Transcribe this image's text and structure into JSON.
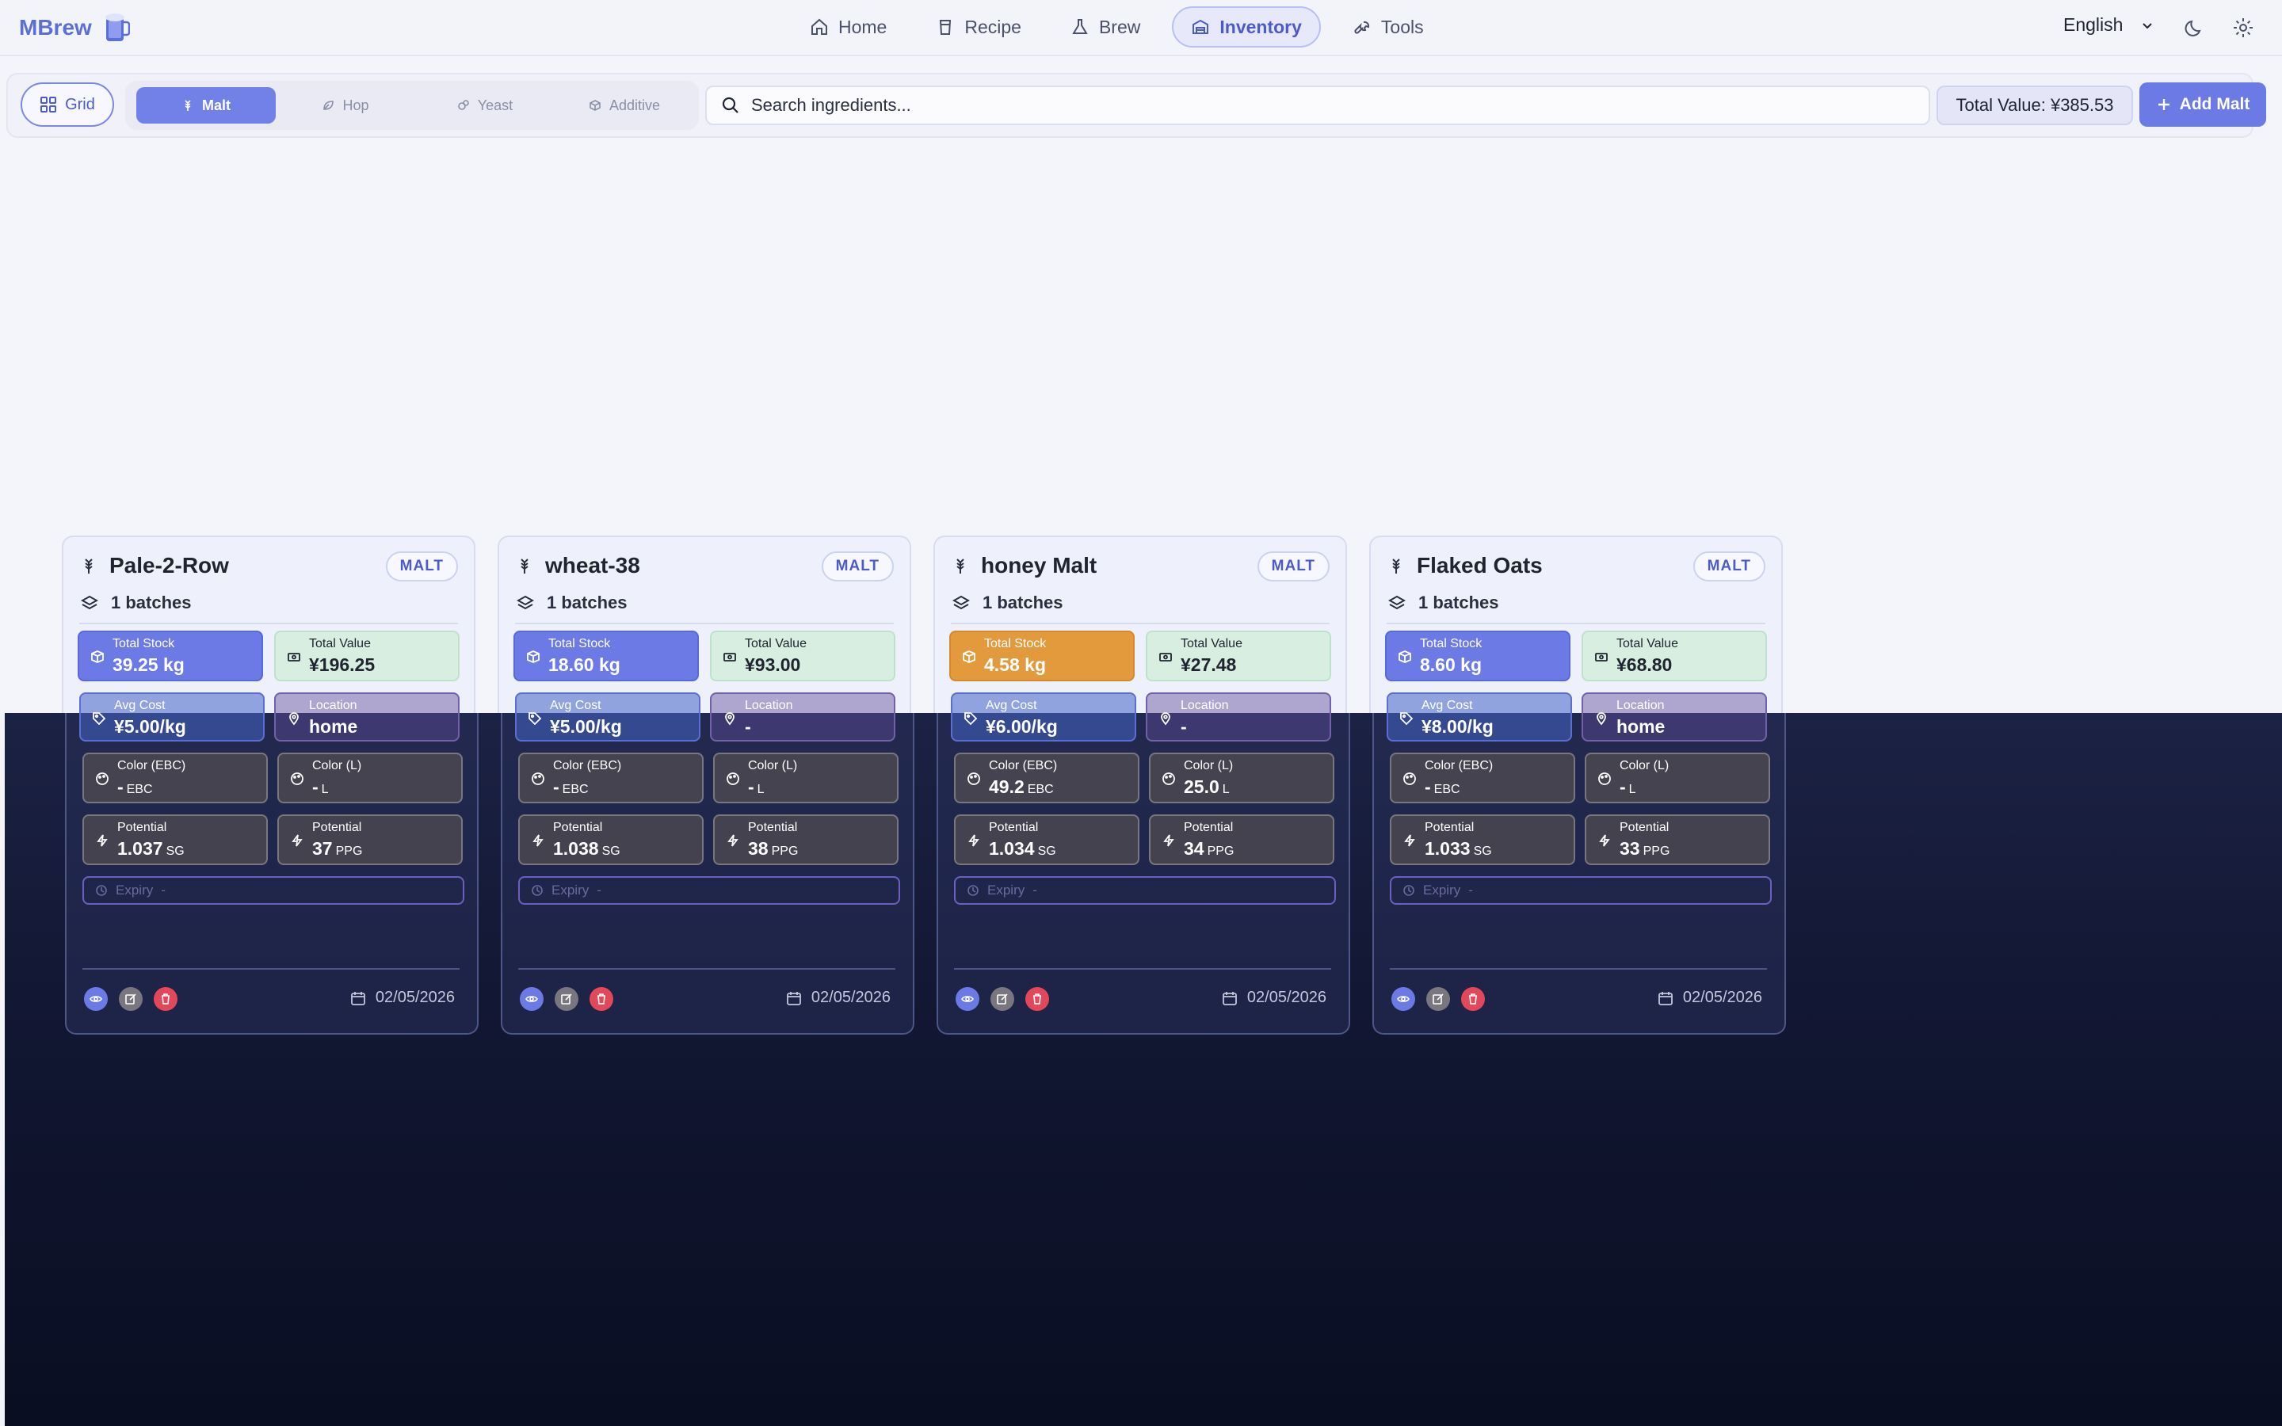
{
  "app": {
    "name": "MBrew"
  },
  "nav": {
    "items": [
      {
        "label": "Home",
        "icon": "home-icon"
      },
      {
        "label": "Recipe",
        "icon": "cup-icon"
      },
      {
        "label": "Brew",
        "icon": "flask-icon"
      },
      {
        "label": "Inventory",
        "icon": "warehouse-icon",
        "active": true
      },
      {
        "label": "Tools",
        "icon": "wrench-icon"
      }
    ],
    "language": "English"
  },
  "toolbar": {
    "grid_label": "Grid",
    "tabs": [
      {
        "label": "Malt",
        "active": true
      },
      {
        "label": "Hop"
      },
      {
        "label": "Yeast"
      },
      {
        "label": "Additive"
      }
    ],
    "search_placeholder": "Search ingredients...",
    "total_value": "Total Value: ¥385.53",
    "add_label": "Add Malt"
  },
  "labels": {
    "total_stock": "Total Stock",
    "total_value": "Total Value",
    "avg_cost": "Avg Cost",
    "location": "Location",
    "color_ebc": "Color (EBC)",
    "color_l": "Color (L)",
    "potential": "Potential",
    "expiry": "Expiry",
    "unit_ebc": "EBC",
    "unit_l": "L",
    "unit_sg": "SG",
    "unit_ppg": "PPG"
  },
  "cards": [
    {
      "name": "Pale-2-Row",
      "type": "MALT",
      "batches": "1 batches",
      "stock": "39.25 kg",
      "value": "¥196.25",
      "cost": "¥5.00/kg",
      "location": "home",
      "ebc": "-",
      "lovibond": "-",
      "sg": "1.037",
      "ppg": "37",
      "expiry": "-",
      "date": "02/05/2026"
    },
    {
      "name": "wheat-38",
      "type": "MALT",
      "batches": "1 batches",
      "stock": "18.60 kg",
      "value": "¥93.00",
      "cost": "¥5.00/kg",
      "location": "-",
      "ebc": "-",
      "lovibond": "-",
      "sg": "1.038",
      "ppg": "38",
      "expiry": "-",
      "date": "02/05/2026"
    },
    {
      "name": "honey Malt",
      "type": "MALT",
      "batches": "1 batches",
      "stock": "4.58 kg",
      "value": "¥27.48",
      "cost": "¥6.00/kg",
      "location": "-",
      "ebc": "49.2",
      "lovibond": "25.0",
      "sg": "1.034",
      "ppg": "34",
      "expiry": "-",
      "date": "02/05/2026"
    },
    {
      "name": "Flaked Oats",
      "type": "MALT",
      "batches": "1 batches",
      "stock": "8.60 kg",
      "value": "¥68.80",
      "cost": "¥8.00/kg",
      "location": "home",
      "ebc": "-",
      "lovibond": "-",
      "sg": "1.033",
      "ppg": "33",
      "expiry": "-",
      "date": "02/05/2026"
    }
  ],
  "colors": {
    "accent": "#6c7ae6",
    "low_stock": "#e39a3c",
    "value_bg": "#d8eee0",
    "danger": "#e2485a"
  }
}
